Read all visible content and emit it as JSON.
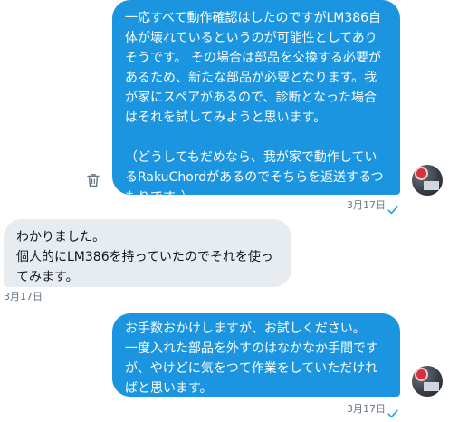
{
  "messages": [
    {
      "direction": "outgoing",
      "text": "一応すべて動作確認はしたのですがLM386自体が壊れているというのが可能性としてありそうです。 その場合は部品を交換する必要があるため、新たな部品が必要となります。我が家にスペアがあるので、診断となった場合はそれを試してみようと思います。\n\n（どうしてもだめなら、我が家で動作しているRakuChordがあるのでそちらを返送するつもりです。）",
      "timestamp": "3月17日"
    },
    {
      "direction": "incoming",
      "text": "わかりました。\n個人的にLM386を持っていたのでそれを使ってみます。",
      "timestamp": "3月17日"
    },
    {
      "direction": "outgoing",
      "text": "お手数おかけしますが、お試しください。\n一度入れた部品を外すのはなかなか手間ですが、やけどに気をつて作業をしていただければと思います。",
      "timestamp": "3月17日"
    }
  ],
  "icons": {
    "delete": "trash-icon",
    "read": "check-icon",
    "avatar": "user-avatar"
  },
  "colors": {
    "outgoing_bubble": "#1b95e0",
    "incoming_bubble": "#e6ecf0",
    "timestamp": "#657786",
    "read_check": "#1da1f2"
  }
}
